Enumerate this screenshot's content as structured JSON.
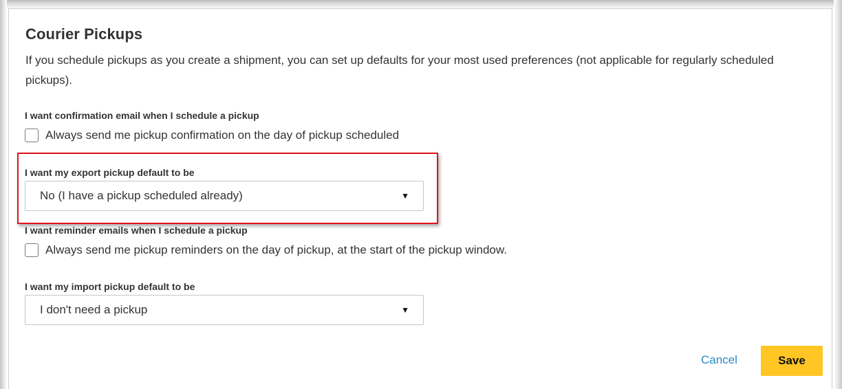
{
  "section": {
    "title": "Courier Pickups",
    "description": "If you schedule pickups as you create a shipment, you can set up defaults for your most used preferences (not applicable for regularly scheduled pickups)."
  },
  "confirmation": {
    "label": "I want confirmation email when I schedule a pickup",
    "checkbox_label": "Always send me pickup confirmation on the day of pickup scheduled",
    "checked": false
  },
  "export_pickup": {
    "label": "I want my export pickup default to be",
    "selected": "No (I have a pickup scheduled already)"
  },
  "reminder": {
    "label": "I want reminder emails when I schedule a pickup",
    "checkbox_label": "Always send me pickup reminders on the day of pickup, at the start of the pickup window.",
    "checked": false
  },
  "import_pickup": {
    "label": "I want my import pickup default to be",
    "selected": "I don't need a pickup"
  },
  "actions": {
    "cancel_label": "Cancel",
    "save_label": "Save"
  },
  "colors": {
    "save_button": "#ffc624",
    "cancel_link": "#2a8bc4",
    "highlight": "#e0141b"
  },
  "icons": {
    "dropdown": "caret-down-icon"
  }
}
